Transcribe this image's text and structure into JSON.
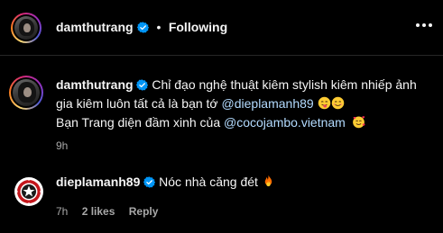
{
  "header": {
    "username": "damthutrang",
    "separator": "•",
    "follow_status": "Following"
  },
  "comments": [
    {
      "username": "damthutrang",
      "text_part1": "Chỉ đạo nghệ thuật kiêm stylish kiêm nhiếp ảnh gia kiêm luôn tất cả là bạn tớ ",
      "mention1": "@dieplamanh89",
      "text_part2": "Bạn Trang diện đầm xinh của ",
      "mention2": "@cocojambo.vietnam",
      "time": "9h"
    },
    {
      "username": "dieplamanh89",
      "text": "Nóc nhà căng đét ",
      "time": "7h",
      "likes": "2 likes",
      "reply_label": "Reply"
    }
  ],
  "icons": {
    "verified": "verified-badge-icon",
    "more": "more-options-icon",
    "emojis": [
      "tongue-out-emoji",
      "smiling-face-emoji",
      "smiling-face-with-hearts-emoji",
      "fire-emoji"
    ]
  },
  "colors": {
    "background": "#000000",
    "text": "#f5f5f5",
    "mention": "#b3dbff",
    "meta": "#a8a8a8",
    "verified": "#0095f6",
    "divider": "#262626"
  }
}
